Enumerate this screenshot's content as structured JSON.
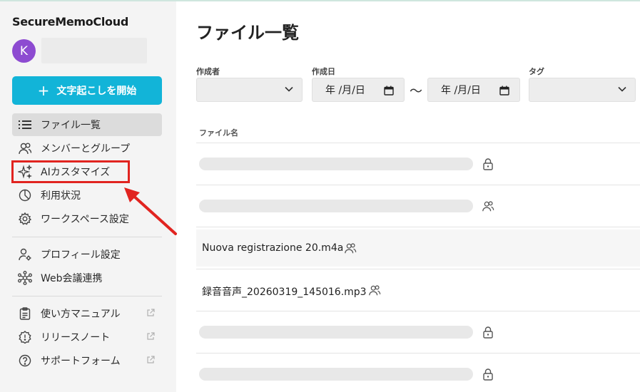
{
  "brand": "SecureMemoCloud",
  "user": {
    "avatar_initial": "K"
  },
  "start_button": {
    "plus": "+",
    "label": "文字起こしを開始"
  },
  "nav": [
    {
      "label": "ファイル一覧",
      "icon": "list-icon",
      "active": true
    },
    {
      "label": "メンバーとグループ",
      "icon": "people-icon"
    },
    {
      "label": "AIカスタマイズ",
      "icon": "sparkle-icon"
    },
    {
      "label": "利用状況",
      "icon": "pie-chart-icon"
    },
    {
      "label": "ワークスペース設定",
      "icon": "gear-icon"
    }
  ],
  "nav2": [
    {
      "label": "プロフィール設定",
      "icon": "profile-settings-icon"
    },
    {
      "label": "Web会議連携",
      "icon": "network-icon"
    }
  ],
  "nav3": [
    {
      "label": "使い方マニュアル",
      "icon": "clipboard-icon",
      "external": true
    },
    {
      "label": "リリースノート",
      "icon": "alert-badge-icon",
      "external": true
    },
    {
      "label": "サポートフォーム",
      "icon": "help-icon",
      "external": true
    }
  ],
  "main": {
    "title": "ファイル一覧",
    "filters": {
      "creator_label": "作成者",
      "created_date_label": "作成日",
      "date_from": "年 /月/日",
      "tilde": "〜",
      "date_to": "年 /月/日",
      "tag_label": "タグ"
    },
    "column_header": "ファイル名",
    "files": [
      {
        "name": "",
        "access_icon": "lock-icon"
      },
      {
        "name": "",
        "access_icon": "people-icon"
      },
      {
        "name": "Nuova registrazione 20.m4a",
        "access_icon": "people-icon"
      },
      {
        "name": "録音音声_20260319_145016.mp3",
        "access_icon": "people-icon"
      },
      {
        "name": "",
        "access_icon": "lock-icon"
      },
      {
        "name": "",
        "access_icon": "lock-icon"
      }
    ]
  },
  "colors": {
    "accent": "#12b4d8",
    "avatar": "#8d4bd1",
    "highlight": "#e12420"
  }
}
